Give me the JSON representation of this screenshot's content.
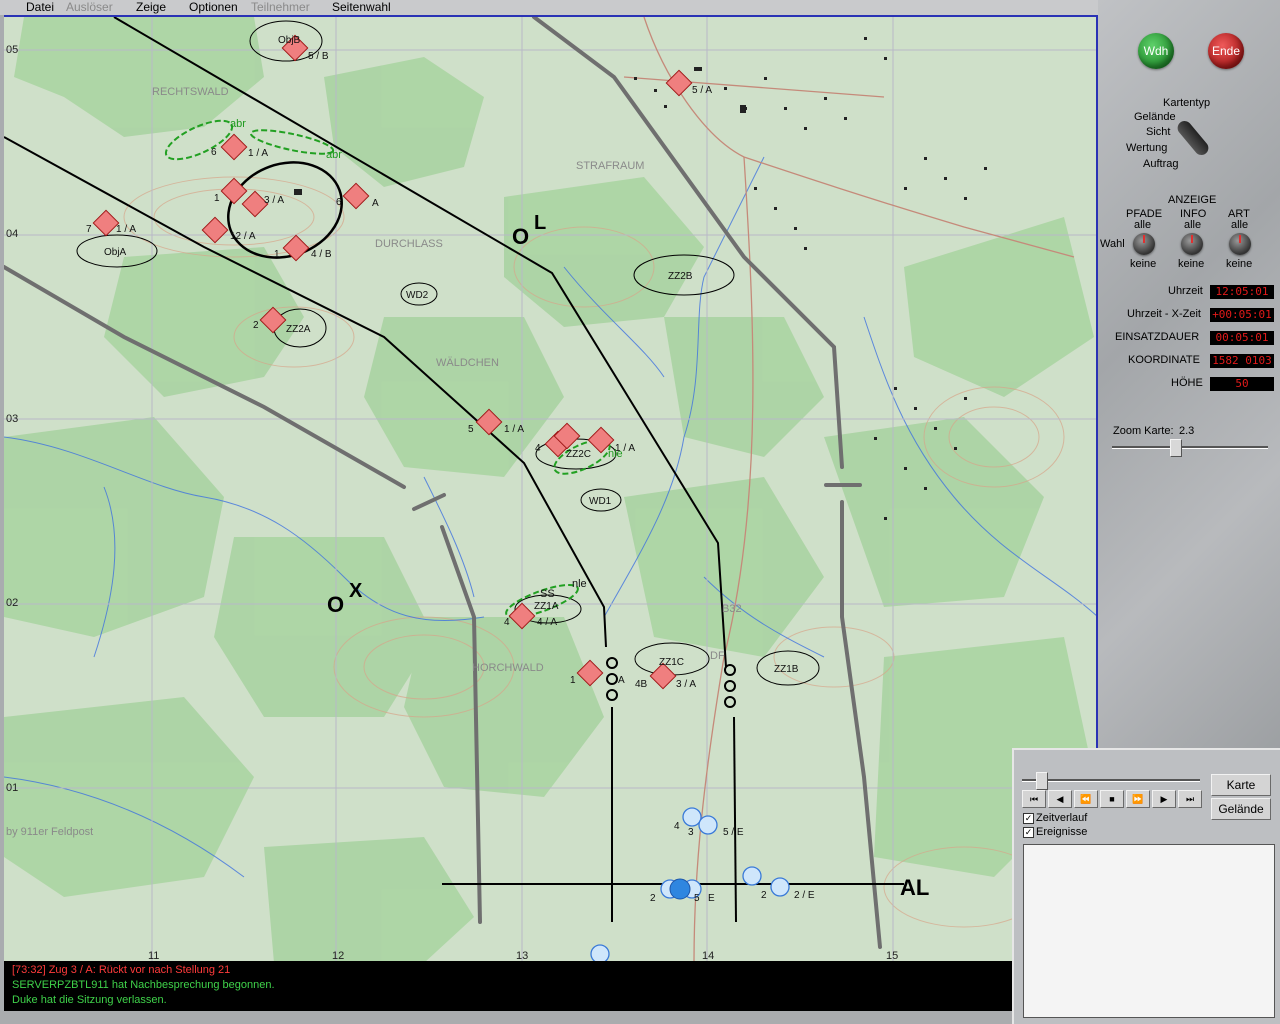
{
  "menu": {
    "datei": "Datei",
    "ausloeser": "Auslöser",
    "zeige": "Zeige",
    "optionen": "Optionen",
    "teilnehmer": "Teilnehmer",
    "seitenwahl": "Seitenwahl"
  },
  "buttons": {
    "wdh": "Wdh",
    "ende": "Ende",
    "wdh_color": "#27a336",
    "ende_color": "#c81e1e"
  },
  "kartentyp": {
    "label": "Kartentyp",
    "options": [
      "Gelände",
      "Sicht",
      "Wertung",
      "Auftrag"
    ]
  },
  "anzeige": {
    "title": "ANZEIGE",
    "pfade": "PFADE",
    "info": "INFO",
    "art": "ART",
    "alle": "alle",
    "wahl": "Wahl",
    "keine": "keine"
  },
  "status": {
    "uhrzeit_label": "Uhrzeit",
    "uhrzeit_value": "12:05:01",
    "xzeit_label": "Uhrzeit - X-Zeit",
    "xzeit_value": "+00:05:01",
    "dauer_label": "EINSATZDAUER",
    "dauer_value": "00:05:01",
    "koord_label": "KOORDINATE",
    "koord_value": "1582 0103",
    "hoehe_label": "HÖHE",
    "hoehe_value": "50"
  },
  "zoom": {
    "label": "Zoom Karte:",
    "value": "2.3"
  },
  "map": {
    "grid_x": [
      "11",
      "12",
      "13",
      "14",
      "15"
    ],
    "grid_y": [
      "05",
      "04",
      "03",
      "02",
      "01"
    ],
    "places": [
      "RECHTSWALD",
      "STRAFRAUM",
      "DURCHLASS",
      "WÄLDCHEN",
      "HORCHWALD",
      "B32",
      "DF"
    ],
    "credit": "by 911er Feldpost",
    "phase_lines": [
      "O",
      "L",
      "O",
      "X",
      "AL"
    ],
    "objectives": [
      "ObjB",
      "ObjA",
      "ZZ2B",
      "ZZ2A",
      "ZZ2C",
      "ZZ1A",
      "ZZ1C",
      "ZZ1B",
      "WD2",
      "WD1"
    ],
    "green_labels": [
      "abr",
      "abr",
      "nle",
      "nle",
      "SS"
    ],
    "unit_labels": [
      "5 / B",
      "5 / A",
      "6",
      "1 / A",
      "1 / A",
      "3 / A",
      "6",
      "A",
      "1",
      "7",
      "1 / A",
      "12 / A",
      "1",
      "4 / B",
      "2",
      "5",
      "1 / A",
      "4",
      "1 / A",
      "4",
      "4 / A",
      "1",
      "A",
      "4B",
      "3 / A",
      "4",
      "3",
      "5 / E",
      "2",
      "5",
      "E",
      "2",
      "2 / E"
    ]
  },
  "log": [
    {
      "text": "[73:32] Zug 3 / A: Rückt vor nach Stellung 21",
      "color": "#ff3b3b"
    },
    {
      "text": "SERVERPZBTL911 hat Nachbesprechung begonnen.",
      "color": "#3fd24a"
    },
    {
      "text": "Duke hat die Sitzung verlassen.",
      "color": "#3fd24a"
    }
  ],
  "replay": {
    "karte": "Karte",
    "gelaende": "Gelände",
    "zeitverlauf": "Zeitverlauf",
    "ereignisse": "Ereignisse",
    "controls": [
      "⏮",
      "◀",
      "⏪",
      "■",
      "⏩",
      "▶",
      "⏭"
    ]
  }
}
